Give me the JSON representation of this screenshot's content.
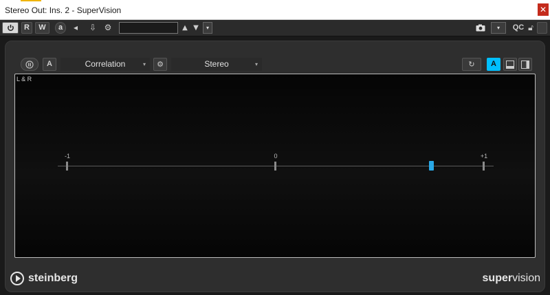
{
  "window": {
    "title": "Stereo Out: Ins. 2 - SuperVision",
    "close_glyph": "✕"
  },
  "toolbar": {
    "power_icon": "power-icon",
    "read_label": "R",
    "write_label": "W",
    "preset_value": "",
    "qc_label": "QC",
    "snapshot_icon": "camera-icon",
    "dropdown_glyph": "▾"
  },
  "plugin": {
    "a_label": "A",
    "module_select": "Correlation",
    "channel_select": "Stereo",
    "a_active_label": "A",
    "caret": "▾"
  },
  "display": {
    "channel_label": "L & R",
    "scale_min_label": "-1",
    "scale_mid_label": "0",
    "scale_max_label": "+1",
    "correlation_value": 0.75,
    "accent_color": "#29a8e6"
  },
  "footer": {
    "brand": "steinberg",
    "product_bold": "super",
    "product_light": "vision"
  }
}
